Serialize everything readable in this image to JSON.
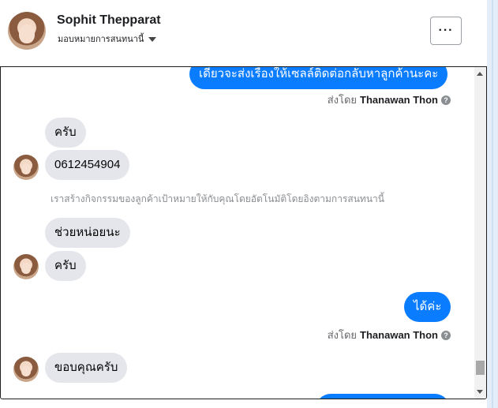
{
  "header": {
    "contact_name": "Sophit Thepparat",
    "assign_label": "มอบหมายการสนทนานี้",
    "more_label": "···"
  },
  "icons": {
    "avatar": "profile-photo",
    "caret": "caret-down-icon",
    "info": "info-icon",
    "scroll_up": "arrow-up-icon",
    "scroll_down": "arrow-down-icon"
  },
  "colors": {
    "outgoing_bubble": "#0a7cff",
    "incoming_bubble": "#e4e6eb"
  },
  "messages": {
    "out_top": "เดี๋ยวจะส่งเรื่องให้เซลล์ติดต่อกลับหาลูกค้านะคะ",
    "sent_by_prefix": "ส่งโดย",
    "sent_by_name": "Thanawan Thon",
    "in_1": "ครับ",
    "in_2": "0612454904",
    "system_note": "เราสร้างกิจกรรมของลูกค้าเป้าหมายให้กับคุณโดยอัตโนมัติโดยอิงตามการสนทนานี้",
    "in_3": "ช่วยหน่อยนะ",
    "in_4": "ครับ",
    "out_2": "ได้ค่ะ",
    "in_5": "ขอบคุณครับ"
  }
}
